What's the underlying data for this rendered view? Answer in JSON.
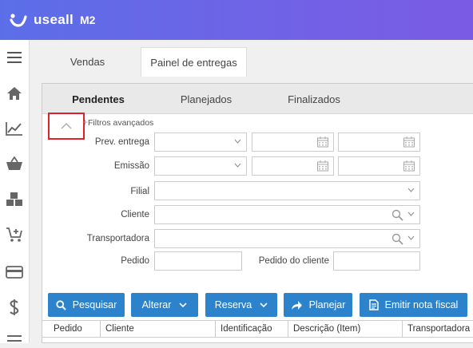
{
  "header": {
    "brand": "useall",
    "version": "M2"
  },
  "sidebar": {
    "icons": [
      "menu-icon",
      "home-icon",
      "chart-icon",
      "basket-icon",
      "boxes-icon",
      "cart-add-icon",
      "card-icon",
      "dollar-icon",
      "list-icon"
    ]
  },
  "main_tabs": [
    {
      "label": "Vendas",
      "active": false
    },
    {
      "label": "Painel de entregas",
      "active": true
    }
  ],
  "subtabs": [
    {
      "label": "Pendentes",
      "active": true
    },
    {
      "label": "Planejados",
      "active": false
    },
    {
      "label": "Finalizados",
      "active": false
    }
  ],
  "filters": {
    "toggle_label": "Filtros avançados",
    "prev_entrega_label": "Prev. entrega",
    "emissao_label": "Emissão",
    "filial_label": "Filial",
    "cliente_label": "Cliente",
    "transportadora_label": "Transportadora",
    "pedido_label": "Pedido",
    "pedido_cliente_label": "Pedido do cliente",
    "prev_entrega_value": "",
    "emissao_value": "",
    "filial_value": "",
    "cliente_value": "",
    "transportadora_value": "",
    "pedido_value": "",
    "pedido_cliente_value": ""
  },
  "actions": {
    "pesquisar": "Pesquisar",
    "alterar": "Alterar",
    "reserva": "Reserva",
    "planejar": "Planejar",
    "emitir": "Emitir nota fiscal"
  },
  "grid": {
    "columns": [
      "Pedido",
      "Cliente",
      "Identificação",
      "Descrição (Item)",
      "Transportadora"
    ]
  },
  "colors": {
    "primary_button": "#2d82cc",
    "header_start": "#5b6ee8",
    "header_end": "#7a5be4",
    "highlight": "#e0202a"
  }
}
